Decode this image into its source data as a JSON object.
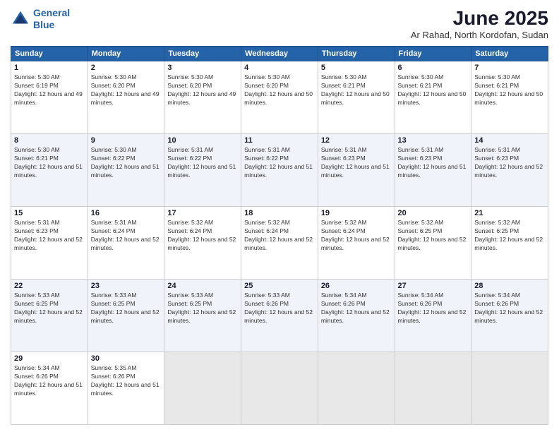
{
  "logo": {
    "line1": "General",
    "line2": "Blue"
  },
  "title": "June 2025",
  "subtitle": "Ar Rahad, North Kordofan, Sudan",
  "weekdays": [
    "Sunday",
    "Monday",
    "Tuesday",
    "Wednesday",
    "Thursday",
    "Friday",
    "Saturday"
  ],
  "weeks": [
    [
      {
        "day": "1",
        "sunrise": "5:30 AM",
        "sunset": "6:19 PM",
        "daylight": "12 hours and 49 minutes."
      },
      {
        "day": "2",
        "sunrise": "5:30 AM",
        "sunset": "6:20 PM",
        "daylight": "12 hours and 49 minutes."
      },
      {
        "day": "3",
        "sunrise": "5:30 AM",
        "sunset": "6:20 PM",
        "daylight": "12 hours and 49 minutes."
      },
      {
        "day": "4",
        "sunrise": "5:30 AM",
        "sunset": "6:20 PM",
        "daylight": "12 hours and 50 minutes."
      },
      {
        "day": "5",
        "sunrise": "5:30 AM",
        "sunset": "6:21 PM",
        "daylight": "12 hours and 50 minutes."
      },
      {
        "day": "6",
        "sunrise": "5:30 AM",
        "sunset": "6:21 PM",
        "daylight": "12 hours and 50 minutes."
      },
      {
        "day": "7",
        "sunrise": "5:30 AM",
        "sunset": "6:21 PM",
        "daylight": "12 hours and 50 minutes."
      }
    ],
    [
      {
        "day": "8",
        "sunrise": "5:30 AM",
        "sunset": "6:21 PM",
        "daylight": "12 hours and 51 minutes."
      },
      {
        "day": "9",
        "sunrise": "5:30 AM",
        "sunset": "6:22 PM",
        "daylight": "12 hours and 51 minutes."
      },
      {
        "day": "10",
        "sunrise": "5:31 AM",
        "sunset": "6:22 PM",
        "daylight": "12 hours and 51 minutes."
      },
      {
        "day": "11",
        "sunrise": "5:31 AM",
        "sunset": "6:22 PM",
        "daylight": "12 hours and 51 minutes."
      },
      {
        "day": "12",
        "sunrise": "5:31 AM",
        "sunset": "6:23 PM",
        "daylight": "12 hours and 51 minutes."
      },
      {
        "day": "13",
        "sunrise": "5:31 AM",
        "sunset": "6:23 PM",
        "daylight": "12 hours and 51 minutes."
      },
      {
        "day": "14",
        "sunrise": "5:31 AM",
        "sunset": "6:23 PM",
        "daylight": "12 hours and 52 minutes."
      }
    ],
    [
      {
        "day": "15",
        "sunrise": "5:31 AM",
        "sunset": "6:23 PM",
        "daylight": "12 hours and 52 minutes."
      },
      {
        "day": "16",
        "sunrise": "5:31 AM",
        "sunset": "6:24 PM",
        "daylight": "12 hours and 52 minutes."
      },
      {
        "day": "17",
        "sunrise": "5:32 AM",
        "sunset": "6:24 PM",
        "daylight": "12 hours and 52 minutes."
      },
      {
        "day": "18",
        "sunrise": "5:32 AM",
        "sunset": "6:24 PM",
        "daylight": "12 hours and 52 minutes."
      },
      {
        "day": "19",
        "sunrise": "5:32 AM",
        "sunset": "6:24 PM",
        "daylight": "12 hours and 52 minutes."
      },
      {
        "day": "20",
        "sunrise": "5:32 AM",
        "sunset": "6:25 PM",
        "daylight": "12 hours and 52 minutes."
      },
      {
        "day": "21",
        "sunrise": "5:32 AM",
        "sunset": "6:25 PM",
        "daylight": "12 hours and 52 minutes."
      }
    ],
    [
      {
        "day": "22",
        "sunrise": "5:33 AM",
        "sunset": "6:25 PM",
        "daylight": "12 hours and 52 minutes."
      },
      {
        "day": "23",
        "sunrise": "5:33 AM",
        "sunset": "6:25 PM",
        "daylight": "12 hours and 52 minutes."
      },
      {
        "day": "24",
        "sunrise": "5:33 AM",
        "sunset": "6:25 PM",
        "daylight": "12 hours and 52 minutes."
      },
      {
        "day": "25",
        "sunrise": "5:33 AM",
        "sunset": "6:26 PM",
        "daylight": "12 hours and 52 minutes."
      },
      {
        "day": "26",
        "sunrise": "5:34 AM",
        "sunset": "6:26 PM",
        "daylight": "12 hours and 52 minutes."
      },
      {
        "day": "27",
        "sunrise": "5:34 AM",
        "sunset": "6:26 PM",
        "daylight": "12 hours and 52 minutes."
      },
      {
        "day": "28",
        "sunrise": "5:34 AM",
        "sunset": "6:26 PM",
        "daylight": "12 hours and 52 minutes."
      }
    ],
    [
      {
        "day": "29",
        "sunrise": "5:34 AM",
        "sunset": "6:26 PM",
        "daylight": "12 hours and 51 minutes."
      },
      {
        "day": "30",
        "sunrise": "5:35 AM",
        "sunset": "6:26 PM",
        "daylight": "12 hours and 51 minutes."
      },
      null,
      null,
      null,
      null,
      null
    ]
  ]
}
